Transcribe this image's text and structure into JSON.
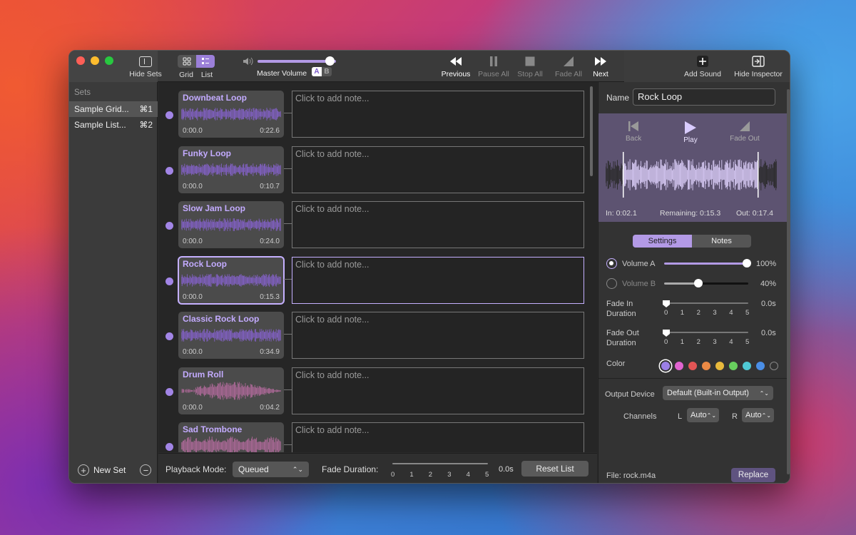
{
  "toolbar": {
    "hide_sets": "Hide Sets",
    "grid": "Grid",
    "list": "List",
    "master_volume": "Master Volume",
    "a": "A",
    "b": "B",
    "previous": "Previous",
    "pause_all": "Pause All",
    "stop_all": "Stop All",
    "fade_all": "Fade All",
    "next": "Next",
    "add_sound": "Add Sound",
    "hide_inspector": "Hide Inspector",
    "master_volume_level": 0.92
  },
  "sidebar": {
    "header": "Sets",
    "items": [
      {
        "label": "Sample Grid...",
        "shortcut": "⌘1"
      },
      {
        "label": "Sample List...",
        "shortcut": "⌘2"
      }
    ],
    "new_set": "New Set"
  },
  "list": {
    "rows": [
      {
        "title": "Downbeat Loop",
        "start": "0:00.0",
        "end": "0:22.6",
        "note": "Click to add note..."
      },
      {
        "title": "Funky Loop",
        "start": "0:00.0",
        "end": "0:10.7",
        "note": "Click to add note..."
      },
      {
        "title": "Slow Jam Loop",
        "start": "0:00.0",
        "end": "0:24.0",
        "note": "Click to add note..."
      },
      {
        "title": "Rock Loop",
        "start": "0:00.0",
        "end": "0:15.3",
        "note": "Click to add note..."
      },
      {
        "title": "Classic Rock Loop",
        "start": "0:00.0",
        "end": "0:34.9",
        "note": "Click to add note..."
      },
      {
        "title": "Drum Roll",
        "start": "0:00.0",
        "end": "0:04.2",
        "note": "Click to add note..."
      },
      {
        "title": "Sad Trombone",
        "start": "",
        "end": "",
        "note": "Click to add note..."
      }
    ]
  },
  "bottom": {
    "playback_mode_label": "Playback Mode:",
    "playback_mode": "Queued",
    "fade_duration_label": "Fade Duration:",
    "fade_value": "0.0s",
    "ticks": [
      "0",
      "1",
      "2",
      "3",
      "4",
      "5"
    ],
    "reset": "Reset List"
  },
  "inspector": {
    "name_label": "Name",
    "name": "Rock Loop",
    "back": "Back",
    "play": "Play",
    "fade_out": "Fade Out",
    "in": "In: 0:02.1",
    "remaining": "Remaining: 0:15.3",
    "out": "Out: 0:17.4",
    "tab_settings": "Settings",
    "tab_notes": "Notes",
    "volume_a": "Volume A",
    "volume_a_val": "100%",
    "volume_b": "Volume B",
    "volume_b_val": "40%",
    "fade_in": "Fade In",
    "fade_in2": "Duration",
    "fade_in_val": "0.0s",
    "fade_out_lbl": "Fade Out",
    "fade_out2": "Duration",
    "fade_out_val": "0.0s",
    "ticks": [
      "0",
      "1",
      "2",
      "3",
      "4",
      "5"
    ],
    "color": "Color",
    "colors": [
      "#9b7fe6",
      "#e064d0",
      "#e25555",
      "#ec8a45",
      "#e8b93c",
      "#68cf5e",
      "#4fc8d4",
      "#4a8ee6",
      "transparent"
    ],
    "output_device": "Output Device",
    "output_value": "Default (Built-in Output)",
    "channels": "Channels",
    "l": "L",
    "r": "R",
    "auto": "Auto",
    "file": "File:  rock.m4a",
    "replace": "Replace"
  }
}
